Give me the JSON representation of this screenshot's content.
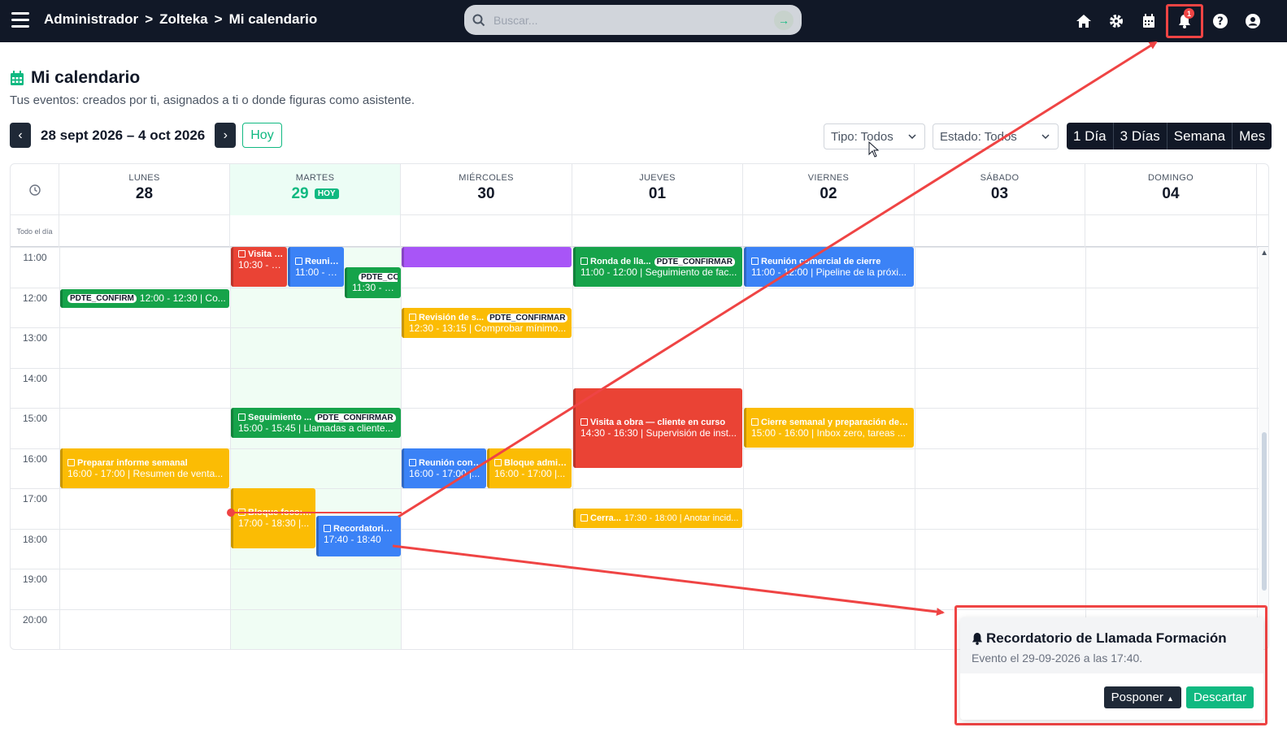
{
  "header": {
    "breadcrumb": [
      "Administrador",
      "Zolteka",
      "Mi calendario"
    ],
    "search_placeholder": "Buscar...",
    "notification_count": "1"
  },
  "page": {
    "title": "Mi calendario",
    "subtitle": "Tus eventos: creados por ti, asignados a ti o donde figuras como asistente."
  },
  "toolbar": {
    "date_range": "28 sept 2026 – 4 oct 2026",
    "today_label": "Hoy",
    "filter_tipo": "Tipo: Todos",
    "filter_estado": "Estado: Todos",
    "views": [
      "1 Día",
      "3 Días",
      "Semana",
      "Mes"
    ]
  },
  "calendar": {
    "days": [
      {
        "name": "LUNES",
        "num": "28"
      },
      {
        "name": "MARTES",
        "num": "29",
        "badge": "HOY"
      },
      {
        "name": "MIÉRCOLES",
        "num": "30"
      },
      {
        "name": "JUEVES",
        "num": "01"
      },
      {
        "name": "VIERNES",
        "num": "02"
      },
      {
        "name": "SÁBADO",
        "num": "03"
      },
      {
        "name": "DOMINGO",
        "num": "04"
      }
    ],
    "allday_label": "Todo el día",
    "hours": [
      "11:00",
      "12:00",
      "13:00",
      "14:00",
      "15:00",
      "16:00",
      "17:00",
      "18:00",
      "19:00",
      "20:00"
    ],
    "events": {
      "mon_pdte": {
        "pill": "PDTE_CONFIRM",
        "sub": "12:00 - 12:30 | Co..."
      },
      "mon_informe": {
        "title": "Preparar informe semanal",
        "sub": "16:00 - 17:00 | Resumen de venta..."
      },
      "tue_visita": {
        "title": "Visita c...",
        "sub": "10:30 - 1..."
      },
      "tue_reunion": {
        "title": "Reunió...",
        "sub": "11:00 - 1..."
      },
      "tue_pdte": {
        "pill": "PDTE_CO",
        "sub": "11:30 - 12..."
      },
      "tue_seguimiento": {
        "title": "Seguimiento ...",
        "pill": "PDTE_CONFIRMAR",
        "sub": "15:00 - 15:45 | Llamadas a cliente..."
      },
      "tue_bloque": {
        "title": "Bloque foco: ...",
        "sub": "17:00 - 18:30 |..."
      },
      "tue_recordatorio": {
        "title": "Recordatorio ...",
        "sub": "17:40 - 18:40"
      },
      "wed_revision": {
        "title": "Revisión de s...",
        "pill": "PDTE_CONFIRMAR",
        "sub": "12:30 - 13:15 | Comprobar mínimo..."
      },
      "wed_reunion": {
        "title": "Reunión con d...",
        "sub": "16:00 - 17:00 |..."
      },
      "wed_bloque": {
        "title": "Bloque admin...",
        "sub": "16:00 - 17:00 |..."
      },
      "thu_ronda": {
        "title": "Ronda de lla...",
        "pill": "PDTE_CONFIRMAR",
        "sub": "11:00 - 12:00 | Seguimiento de fac..."
      },
      "thu_visita": {
        "title": "Visita a obra — cliente en curso",
        "sub": "14:30 - 16:30 | Supervisión de inst..."
      },
      "thu_cerra": {
        "title": "Cerra...",
        "sub": "17:30 - 18:00 | Anotar incid..."
      },
      "fri_reunion": {
        "title": "Reunión comercial de cierre",
        "sub": "11:00 - 12:00 | Pipeline de la próxi..."
      },
      "fri_cierre": {
        "title": "Cierre semanal y preparación del lu...",
        "sub": "15:00 - 16:00 | Inbox zero, tareas ..."
      }
    }
  },
  "toast": {
    "title": "Recordatorio de Llamada Formación",
    "subtitle": "Evento el 29-09-2026 a las 17:40.",
    "postpone_label": "Posponer",
    "dismiss_label": "Descartar"
  },
  "colors": {
    "topbar": "#111827",
    "accent": "#10b981",
    "annotation": "#ef4444",
    "event_red": "#ea4335",
    "event_blue": "#3b82f6",
    "event_green": "#16a34a",
    "event_yellow": "#fbbc04",
    "event_purple": "#a855f7"
  }
}
